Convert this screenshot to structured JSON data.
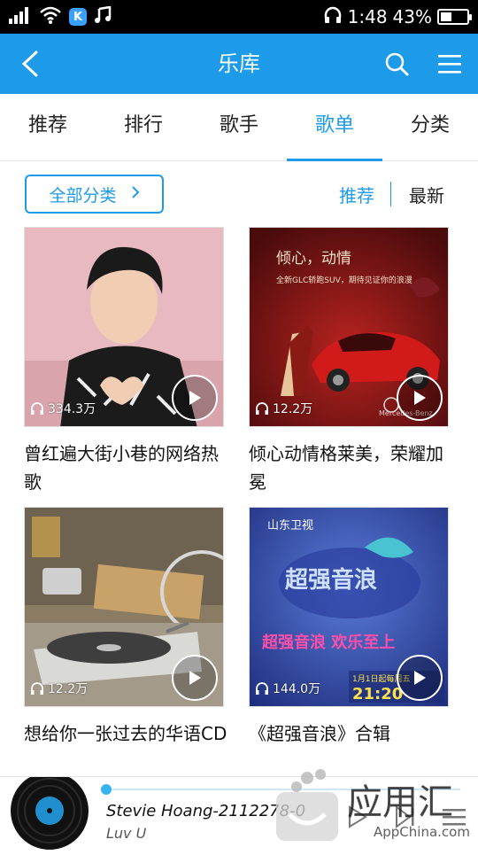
{
  "status_bar": {
    "time": "1:48",
    "battery_percent": "43%",
    "battery_level": 0.43,
    "icons": [
      "signal-icon",
      "wifi-icon",
      "kugou-k-icon",
      "music-note-icon",
      "headphone-icon",
      "battery-icon"
    ],
    "k_badge": "K"
  },
  "app_bar": {
    "title": "乐库",
    "color": "#1e9be8",
    "icons": [
      "back-icon",
      "search-icon",
      "menu-icon"
    ]
  },
  "tabs": [
    {
      "label": "推荐"
    },
    {
      "label": "排行"
    },
    {
      "label": "歌手"
    },
    {
      "label": "歌单",
      "active": true
    },
    {
      "label": "分类"
    }
  ],
  "filter": {
    "all_categories_label": "全部分类",
    "sort_recommended": "推荐",
    "sort_latest": "最新",
    "active_sort": "推荐"
  },
  "playlists": [
    {
      "title": "曾红遍大街小巷的网络热歌",
      "plays": "334.3万",
      "cover": "pink-portrait"
    },
    {
      "title": "倾心动情格莱美，荣耀加冕",
      "plays": "12.2万",
      "cover": "red-car-ad",
      "cover_text": {
        "headline": "倾心，动情",
        "subline": "全新GLC轿跑SUV，期待见证你的浪漫",
        "brand": "Mercedes-Benz"
      }
    },
    {
      "title": "想给你一张过去的华语CD",
      "plays": "12.2万",
      "cover": "turntable"
    },
    {
      "title": "《超强音浪》合辑",
      "plays": "144.0万",
      "cover": "tv-show",
      "cover_text": {
        "channel": "山东卫视",
        "show": "超强音浪",
        "slogan": "超强音浪 欢乐至上",
        "schedule": "1月1日起每周五",
        "time": "21:20"
      }
    }
  ],
  "player": {
    "song": "Stevie Hoang-2112278-0",
    "artist": "Luv U",
    "progress": 0.0
  },
  "watermark": {
    "text_cn": "应用汇",
    "text_en": "AppChina.com"
  }
}
